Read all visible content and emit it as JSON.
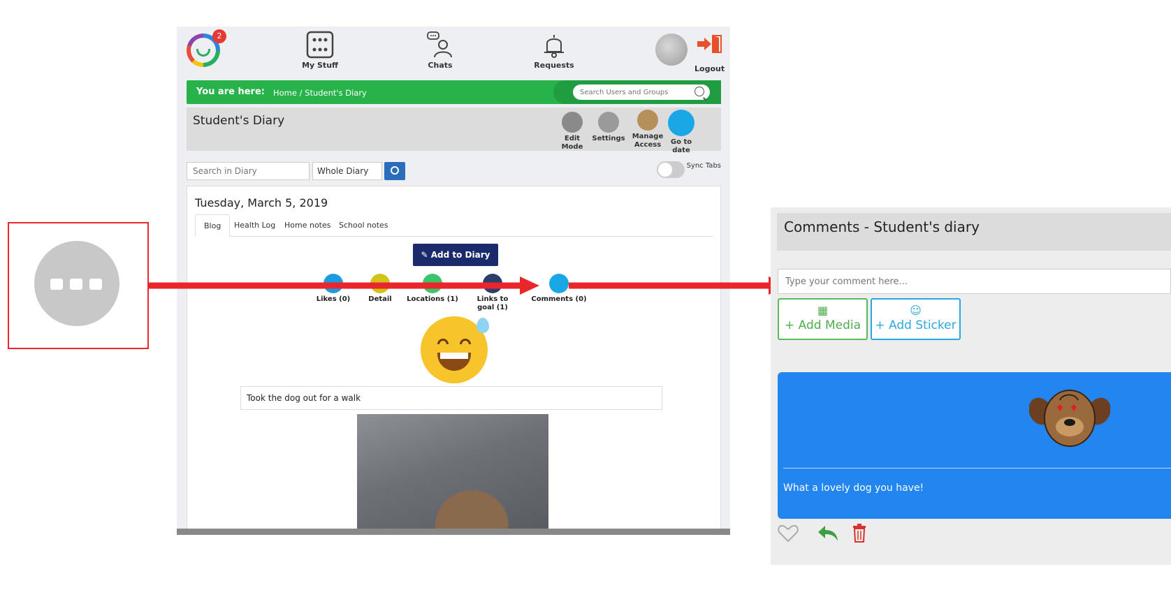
{
  "app": {
    "logo_badge": "2",
    "nav": {
      "my_stuff": "My Stuff",
      "chats": "Chats",
      "requests": "Requests",
      "logout": "Logout"
    },
    "breadcrumb": {
      "prefix": "You are here:",
      "path": "Home  /  Student's Diary"
    },
    "search_users_placeholder": "Search Users and Groups",
    "page_title": "Student's Diary",
    "tools": {
      "edit_mode": "Edit Mode",
      "settings": "Settings",
      "manage_access": "Manage Access",
      "go_to_date": "Go to date"
    },
    "diary_search": {
      "placeholder": "Search in Diary",
      "scope": "Whole Diary",
      "sync_label": "Sync Tabs"
    },
    "entry": {
      "date": "Tuesday, March 5, 2019",
      "tabs": [
        "Blog",
        "Health Log",
        "Home notes",
        "School notes"
      ],
      "add_button": "Add to Diary",
      "actions": {
        "likes": "Likes (0)",
        "detail": "Detail",
        "locations": "Locations (1)",
        "links_to_goal": "Links to goal (1)",
        "comments": "Comments (0)"
      },
      "note_text": "Took the dog out for a walk"
    }
  },
  "comments_panel": {
    "title": "Comments - Student's diary",
    "input_placeholder": "Type your comment here...",
    "add_media": "+ Add Media",
    "add_sticker": "+ Add Sticker",
    "comment_text": "What a lovely dog you have!"
  },
  "colors": {
    "annotation_red": "#e8262b",
    "green_bar": "#27b34a",
    "navy_button": "#1b2a6b",
    "comment_blue": "#2386f0"
  }
}
